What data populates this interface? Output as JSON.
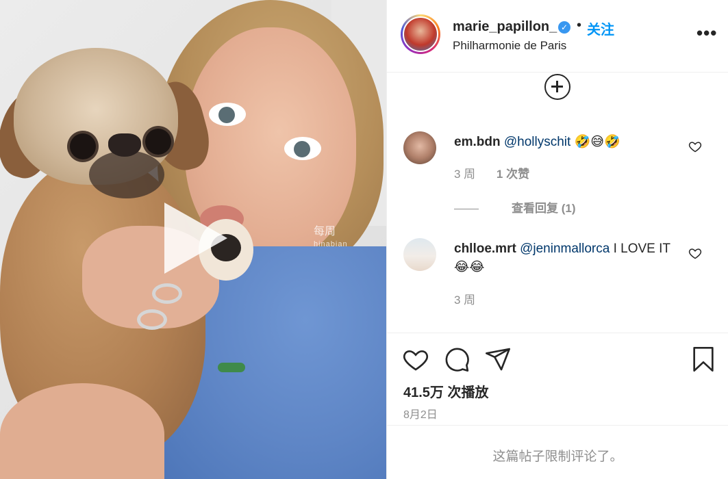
{
  "media": {
    "watermark_cn": "每周",
    "watermark_en": "hinabian",
    "play_icon": "play-icon"
  },
  "header": {
    "username": "marie_papillon_",
    "verified_icon": "verified-badge-icon",
    "separator": "•",
    "follow_label": "关注",
    "location": "Philharmonie de Paris",
    "more_icon": "more-options-icon",
    "more_label": "•••"
  },
  "load_more_icon": "plus-circle-icon",
  "comments": [
    {
      "username": "em.bdn",
      "mention": "@hollyschit",
      "text": " 🤣😅🤣",
      "time": "3 周",
      "likes": "1 次赞",
      "replies": "查看回复 (1)"
    },
    {
      "username": "chlloe.mrt",
      "mention": "@jeninmallorca",
      "text": " I LOVE IT😂😂",
      "time": "3 周"
    }
  ],
  "actions": {
    "like_icon": "heart-icon",
    "comment_icon": "comment-icon",
    "share_icon": "share-icon",
    "save_icon": "bookmark-icon"
  },
  "stats": {
    "views": "41.5万 次播放",
    "date": "8月2日"
  },
  "footer": {
    "restricted": "这篇帖子限制评论了。"
  },
  "colors": {
    "accent": "#0095f6",
    "mention": "#00376b",
    "muted": "#8e8e8e",
    "text": "#262626"
  }
}
